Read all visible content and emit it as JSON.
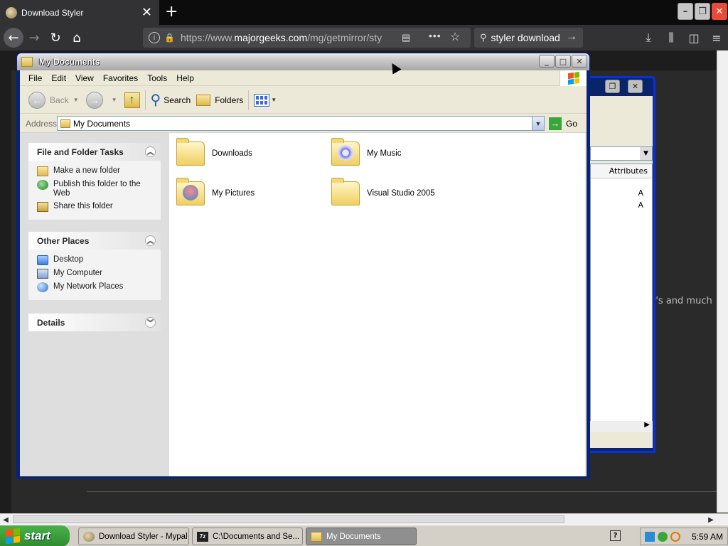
{
  "browser": {
    "tab_title": "Download Styler",
    "tab_close": "✕",
    "new_tab": "+",
    "url_prefix": "https://www.",
    "url_domain": "majorgeeks.com",
    "url_path": "/mg/getmirror/sty",
    "search_text": "styler download",
    "webpage_snippet": "r's and much"
  },
  "window2": {
    "attributes_header": "Attributes",
    "rows": [
      "A",
      "A"
    ]
  },
  "explorer": {
    "title": "My Documents",
    "menu": [
      "File",
      "Edit",
      "View",
      "Favorites",
      "Tools",
      "Help"
    ],
    "toolbar": {
      "back": "Back",
      "search": "Search",
      "folders": "Folders"
    },
    "address": {
      "label": "Address",
      "value": "My Documents",
      "go": "Go"
    },
    "panels": {
      "tasks": {
        "title": "File and Folder Tasks",
        "items": [
          "Make a new folder",
          "Publish this folder to the Web",
          "Share this folder"
        ]
      },
      "places": {
        "title": "Other Places",
        "items": [
          "Desktop",
          "My Computer",
          "My Network Places"
        ]
      },
      "details": {
        "title": "Details"
      }
    },
    "folders": [
      {
        "name": "Downloads",
        "icon": "folder-icon"
      },
      {
        "name": "My Music",
        "icon": "music-folder-icon"
      },
      {
        "name": "My Pictures",
        "icon": "pictures-folder-icon"
      },
      {
        "name": "Visual Studio 2005",
        "icon": "folder-icon"
      }
    ]
  },
  "taskbar": {
    "start": "start",
    "tasks": [
      "Download Styler - Mypal",
      "C:\\Documents and Se...",
      "My Documents"
    ],
    "clock": "5:59 AM"
  },
  "colors": {
    "xp_title_gradient": "#c8c8c8",
    "start_green": "#3a9a3a",
    "browser_bg": "#323234"
  }
}
